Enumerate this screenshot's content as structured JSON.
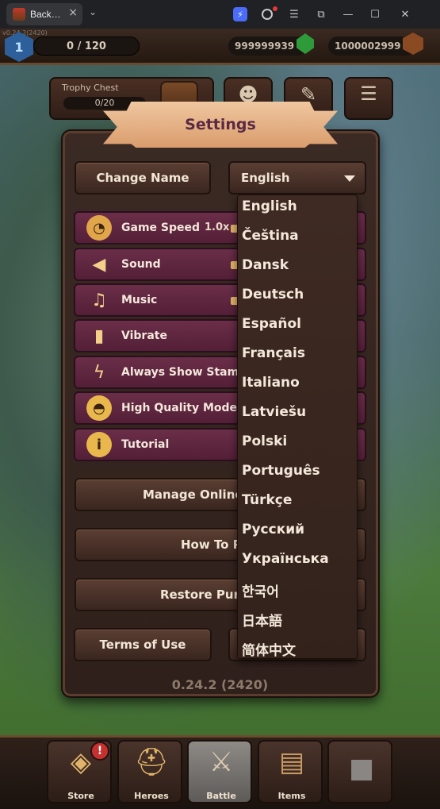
{
  "browser": {
    "tab_title": "Back…",
    "close": "×",
    "dropdown": "⌄"
  },
  "game": {
    "version_small": "v0.24.2(2420)",
    "level": "1",
    "xp": "0 / 120",
    "gems": "999999939",
    "coins": "1000002999",
    "trophy_chest": {
      "title": "Trophy Chest",
      "progress": "0/20"
    }
  },
  "settings": {
    "title": "Settings",
    "change_name": "Change Name",
    "language": "English",
    "rows": [
      {
        "icon": "speedometer-icon",
        "label": "Game Speed",
        "value": "1.0x"
      },
      {
        "icon": "speaker-icon",
        "label": "Sound"
      },
      {
        "icon": "music-note-icon",
        "label": "Music"
      },
      {
        "icon": "vibrate-icon",
        "label": "Vibrate"
      },
      {
        "icon": "lightning-icon",
        "label": "Always Show Stamina"
      },
      {
        "icon": "gauge-icon",
        "label": "High Quality Mode"
      },
      {
        "icon": "info-icon",
        "label": "Tutorial"
      }
    ],
    "manage_online": "Manage Online",
    "how_to": "How To P",
    "restore": "Restore Pur",
    "terms": "Terms of Use",
    "version": "0.24.2 (2420)"
  },
  "language_options": [
    "English",
    "Čeština",
    "Dansk",
    "Deutsch",
    "Español",
    "Français",
    "Italiano",
    "Latviešu",
    "Polski",
    "Português",
    "Türkçe",
    "Русский",
    "Українська",
    "한국어",
    "日本語",
    "简体中文"
  ],
  "nav": {
    "items": [
      "Store",
      "Heroes",
      "Battle",
      "Items"
    ],
    "badge": "!"
  }
}
